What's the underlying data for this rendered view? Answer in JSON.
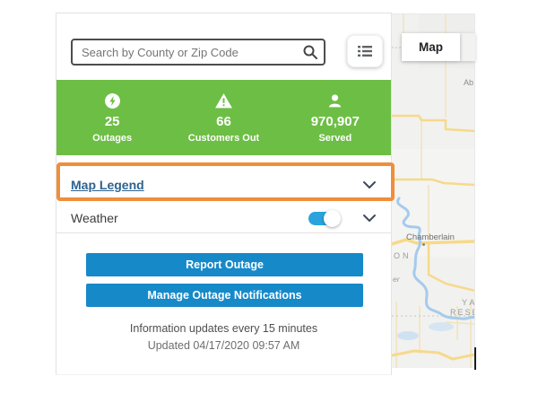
{
  "colors": {
    "stats_green": "#6dbe45",
    "button_blue": "#1689c9",
    "toggle_blue": "#2ba3dc",
    "legend_link_blue": "#2d6390",
    "highlight_orange": "#ef8e3b"
  },
  "sidebar": {
    "search_placeholder": "Search by County or Zip Code",
    "stats": [
      {
        "icon": "bolt-circle-icon",
        "value": "25",
        "label": "Outages"
      },
      {
        "icon": "warning-triangle-icon",
        "value": "66",
        "label": "Customers Out"
      },
      {
        "icon": "person-icon",
        "value": "970,907",
        "label": "Served"
      }
    ],
    "legend": {
      "label": "Map Legend"
    },
    "weather": {
      "label": "Weather",
      "toggle_on": true
    },
    "actions": [
      {
        "label": "Report Outage"
      },
      {
        "label": "Manage Outage Notifications"
      }
    ],
    "footer": {
      "line1": "Information updates every 15 minutes",
      "line2": "Updated 04/17/2020 09:57 AM"
    }
  },
  "map": {
    "tab": "Map",
    "labels": {
      "city": "Chamberlain",
      "truncated_top_right": "Ab",
      "reservation_on": "ON",
      "river_er": "er",
      "reservation_ya": "YA",
      "reservation_rese": "RESE"
    }
  }
}
